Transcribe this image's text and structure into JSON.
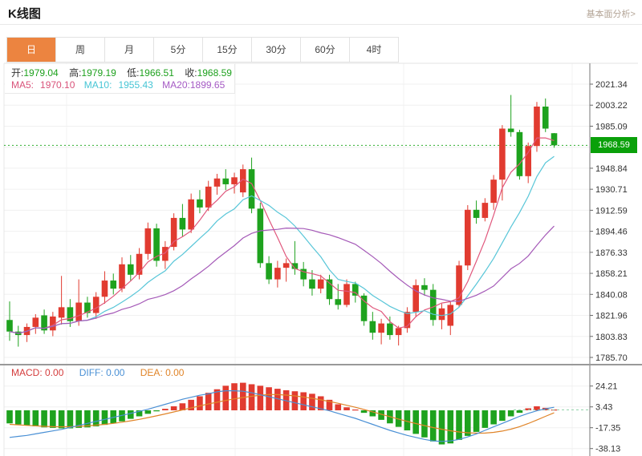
{
  "header": {
    "title": "K线图",
    "link": "基本面分析>"
  },
  "tabs": {
    "items": [
      "日",
      "周",
      "月",
      "5分",
      "15分",
      "30分",
      "60分",
      "4时"
    ],
    "active_index": 0
  },
  "info": {
    "open_label": "开:",
    "open": "1979.04",
    "high_label": "高:",
    "high": "1979.19",
    "low_label": "低:",
    "low": "1966.51",
    "close_label": "收:",
    "close": "1968.59",
    "ma5_label": "MA5:",
    "ma5": "1970.10",
    "ma10_label": "MA10:",
    "ma10": "1955.43",
    "ma20_label": "MA20:",
    "ma20": "1899.65"
  },
  "macd_legend": {
    "macd_label": "MACD:",
    "macd": "0.00",
    "diff_label": "DIFF:",
    "diff": "0.00",
    "dea_label": "DEA:",
    "dea": "0.00"
  },
  "colors": {
    "accent_orange": "#ec8440",
    "candle_up_red": "#e13b30",
    "candle_down_green": "#1ea21e",
    "badge_green": "#0aa00a",
    "current_line_green": "#2fae2f",
    "ma5_pink": "#e0577c",
    "ma10_cyan": "#58c6d8",
    "ma20_purple": "#a55ab8",
    "diff_blue": "#4a90d5",
    "dea_orange": "#e08428",
    "grid": "#f0f0f0",
    "axis": "#777777"
  },
  "chart_data": [
    {
      "type": "candlestick",
      "title": "K线图 (daily)",
      "legend": [
        "MA5",
        "MA10",
        "MA20"
      ],
      "ma_windows": [
        5,
        10,
        20
      ],
      "current_price": 1968.59,
      "current_price_label": "1968.59",
      "ylim": [
        1779.5,
        2039.5
      ],
      "grid": true,
      "y_axis_labels": [
        "2021.34",
        "2003.22",
        "1985.09",
        "1948.84",
        "1930.71",
        "1912.59",
        "1894.46",
        "1876.33",
        "1858.21",
        "1840.08",
        "1821.96",
        "1803.83",
        "1785.70"
      ],
      "hidden_grid_level": 1966.96,
      "candles_ohlc": [
        [
          1818,
          1834,
          1800,
          1808
        ],
        [
          1808,
          1813,
          1795,
          1805
        ],
        [
          1805,
          1815,
          1799,
          1812
        ],
        [
          1812,
          1823,
          1806,
          1820
        ],
        [
          1822,
          1827,
          1806,
          1809
        ],
        [
          1809,
          1825,
          1804,
          1821
        ],
        [
          1820,
          1856,
          1814,
          1829
        ],
        [
          1829,
          1836,
          1812,
          1817
        ],
        [
          1817,
          1853,
          1813,
          1833
        ],
        [
          1833,
          1838,
          1820,
          1824
        ],
        [
          1824,
          1842,
          1819,
          1838
        ],
        [
          1838,
          1860,
          1832,
          1852
        ],
        [
          1852,
          1858,
          1840,
          1845
        ],
        [
          1845,
          1872,
          1842,
          1866
        ],
        [
          1866,
          1874,
          1852,
          1857
        ],
        [
          1857,
          1880,
          1853,
          1875
        ],
        [
          1875,
          1902,
          1870,
          1897
        ],
        [
          1897,
          1901,
          1864,
          1869
        ],
        [
          1869,
          1886,
          1862,
          1881
        ],
        [
          1881,
          1910,
          1878,
          1906
        ],
        [
          1906,
          1918,
          1890,
          1896
        ],
        [
          1896,
          1927,
          1893,
          1922
        ],
        [
          1922,
          1930,
          1910,
          1915
        ],
        [
          1915,
          1938,
          1912,
          1933
        ],
        [
          1933,
          1944,
          1926,
          1940
        ],
        [
          1940,
          1948,
          1930,
          1935
        ],
        [
          1935,
          1945,
          1927,
          1941
        ],
        [
          1928,
          1952,
          1924,
          1948
        ],
        [
          1948,
          1958,
          1910,
          1914
        ],
        [
          1914,
          1919,
          1863,
          1867
        ],
        [
          1867,
          1873,
          1849,
          1853
        ],
        [
          1853,
          1869,
          1846,
          1863
        ],
        [
          1863,
          1871,
          1851,
          1867
        ],
        [
          1867,
          1886,
          1857,
          1862
        ],
        [
          1862,
          1868,
          1847,
          1853
        ],
        [
          1853,
          1861,
          1839,
          1845
        ],
        [
          1845,
          1857,
          1841,
          1853
        ],
        [
          1853,
          1857,
          1831,
          1836
        ],
        [
          1836,
          1849,
          1827,
          1831
        ],
        [
          1831,
          1853,
          1829,
          1849
        ],
        [
          1849,
          1851,
          1833,
          1839
        ],
        [
          1839,
          1841,
          1813,
          1817
        ],
        [
          1817,
          1825,
          1801,
          1807
        ],
        [
          1807,
          1819,
          1797,
          1815
        ],
        [
          1815,
          1821,
          1801,
          1805
        ],
        [
          1805,
          1813,
          1796,
          1811
        ],
        [
          1811,
          1829,
          1807,
          1825
        ],
        [
          1825,
          1853,
          1821,
          1848
        ],
        [
          1848,
          1854,
          1839,
          1844
        ],
        [
          1844,
          1849,
          1813,
          1818
        ],
        [
          1818,
          1832,
          1810,
          1828
        ],
        [
          1813,
          1834,
          1805,
          1831
        ],
        [
          1831,
          1869,
          1829,
          1865
        ],
        [
          1865,
          1917,
          1861,
          1913
        ],
        [
          1913,
          1921,
          1901,
          1906
        ],
        [
          1906,
          1923,
          1903,
          1919
        ],
        [
          1919,
          1943,
          1913,
          1939
        ],
        [
          1939,
          1986,
          1921,
          1983
        ],
        [
          1983,
          2012,
          1976,
          1980
        ],
        [
          1980,
          1982,
          1939,
          1942
        ],
        [
          1942,
          1971,
          1936,
          1968
        ],
        [
          1968,
          2006,
          1963,
          2002
        ],
        [
          2002,
          2009,
          1980,
          1983
        ],
        [
          1979.04,
          1979.19,
          1966.51,
          1968.59
        ]
      ]
    },
    {
      "type": "bar",
      "title": "MACD",
      "legend": [
        "MACD",
        "DIFF",
        "DEA"
      ],
      "y_axis_labels": [
        "24.21",
        "3.43",
        "-17.35",
        "-38.13"
      ],
      "current": 0.5,
      "values": [
        -13,
        -14,
        -15,
        -16,
        -17,
        -17.5,
        -18,
        -18,
        -17.5,
        -17,
        -16,
        -14.5,
        -13,
        -11,
        -8.5,
        -6,
        -3.5,
        -1,
        1.5,
        4,
        7,
        10.5,
        14,
        17.5,
        21,
        24.5,
        27,
        27.5,
        26,
        24.5,
        23,
        21.5,
        20,
        19,
        18,
        16.5,
        14,
        10.5,
        6,
        3,
        0.8,
        -2.5,
        -6,
        -9.5,
        -13,
        -16.5,
        -20,
        -23.5,
        -27,
        -31,
        -34,
        -33,
        -29.5,
        -25.5,
        -21.5,
        -17.5,
        -14,
        -10.5,
        -6,
        -2.5,
        2,
        4,
        2.5,
        0.8
      ],
      "diff": [
        -27,
        -26,
        -25,
        -23.5,
        -22,
        -20.5,
        -19,
        -17,
        -15,
        -13,
        -11,
        -9,
        -7,
        -5,
        -3,
        -1,
        1,
        3.5,
        6,
        8.5,
        11,
        13,
        15,
        16.5,
        18.5,
        19.5,
        19.5,
        19,
        17.5,
        15.5,
        13.5,
        11.5,
        9.5,
        7.5,
        5.5,
        3.5,
        1.5,
        -0.5,
        -3,
        -5.5,
        -8,
        -11,
        -14,
        -17,
        -20,
        -22.5,
        -25,
        -27,
        -29,
        -30.5,
        -31,
        -30.5,
        -29,
        -26.5,
        -23.5,
        -20,
        -16.5,
        -13,
        -9.5,
        -6,
        -3,
        -0.5,
        1.5,
        3
      ],
      "dea": [
        -14,
        -14.5,
        -15,
        -15.5,
        -16,
        -16.3,
        -16.4,
        -16.3,
        -16,
        -15.5,
        -14.8,
        -14,
        -13,
        -11.8,
        -10.5,
        -9,
        -7.3,
        -5.5,
        -3.6,
        -1.6,
        0.4,
        2.4,
        4.4,
        6.3,
        8.1,
        9.8,
        11.4,
        12.8,
        14,
        15,
        15.8,
        15.7,
        15.2,
        14.4,
        13.3,
        12,
        10.5,
        8.8,
        7,
        5,
        3,
        0.8,
        -1.5,
        -3.9,
        -6.3,
        -8.7,
        -11,
        -13.2,
        -15.3,
        -17.2,
        -18.9,
        -20.4,
        -21.6,
        -22.4,
        -22.8,
        -22.7,
        -22,
        -20.7,
        -18.8,
        -16.3,
        -13.2,
        -9.7,
        -6,
        -2.5
      ]
    }
  ]
}
